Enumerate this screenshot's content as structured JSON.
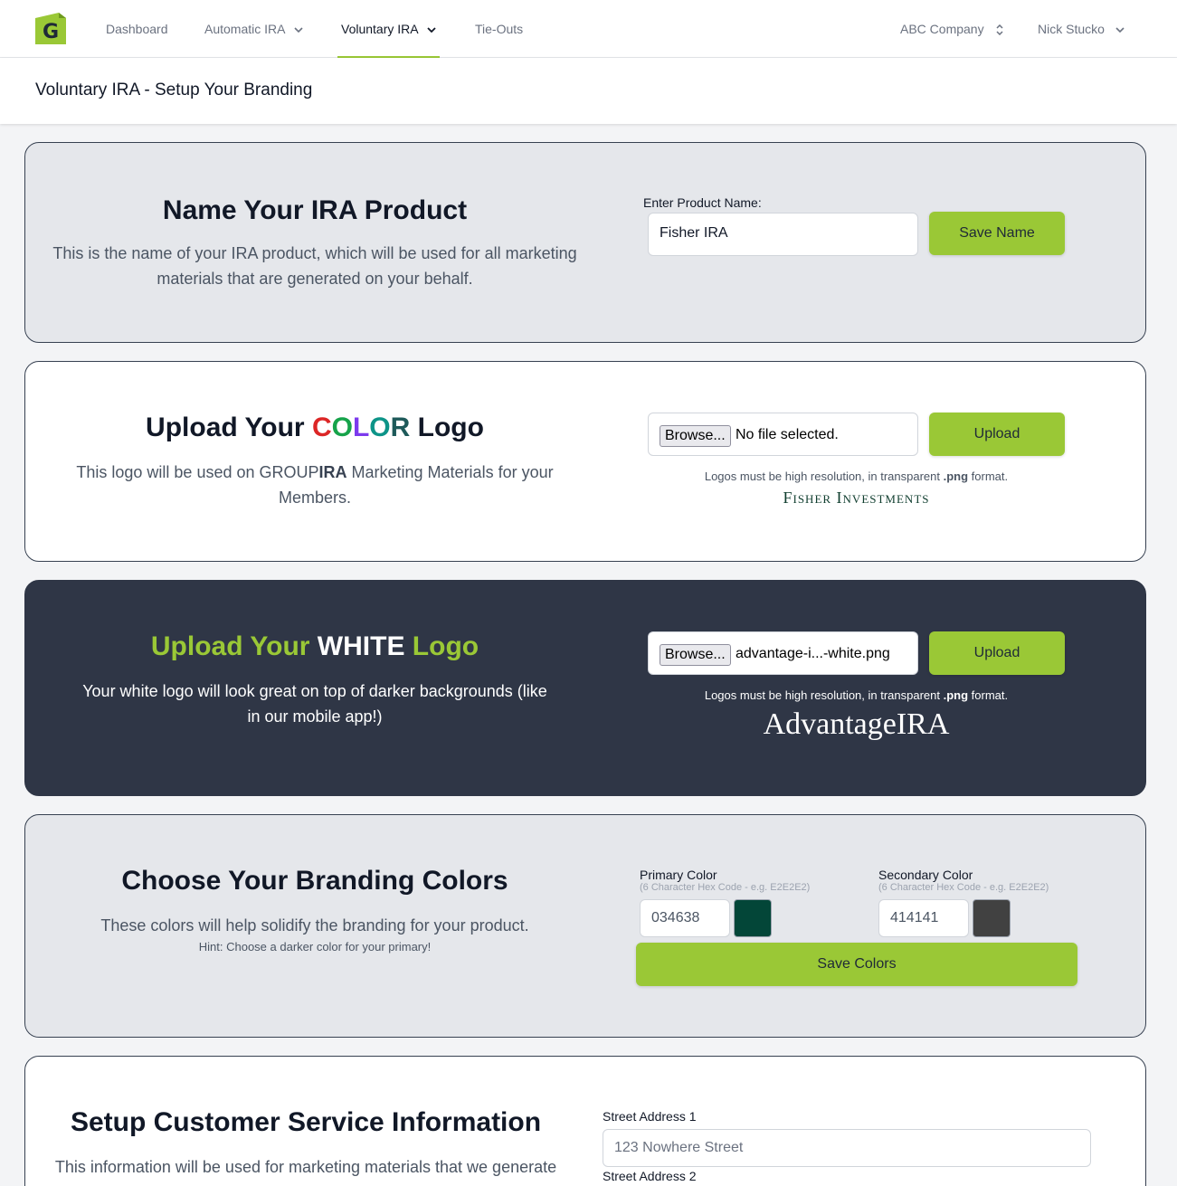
{
  "nav": {
    "items": [
      {
        "label": "Dashboard"
      },
      {
        "label": "Automatic IRA"
      },
      {
        "label": "Voluntary IRA"
      },
      {
        "label": "Tie-Outs"
      }
    ],
    "company": "ABC Company",
    "user": "Nick Stucko"
  },
  "page": {
    "title": "Voluntary IRA - Setup Your Branding"
  },
  "name_section": {
    "title": "Name Your IRA Product",
    "description": "This is the name of your IRA product, which will be used for all marketing materials that are generated on your behalf.",
    "field_label": "Enter Product Name:",
    "field_value": "Fisher IRA",
    "button": "Save Name"
  },
  "color_logo": {
    "title_prefix": "Upload Your ",
    "title_letters": [
      {
        "ch": "C",
        "color": "#dc2626"
      },
      {
        "ch": "O",
        "color": "#16a34a"
      },
      {
        "ch": "L",
        "color": "#7c3aed"
      },
      {
        "ch": "O",
        "color": "#0d9488"
      },
      {
        "ch": "R",
        "color": "#1e5a5a"
      }
    ],
    "title_suffix": " Logo",
    "description_prefix": "This logo will be used on GROUP",
    "description_bold": "IRA",
    "description_suffix": " Marketing Materials for your Members.",
    "browse": "Browse...",
    "file_name": "No file selected.",
    "button": "Upload",
    "note_prefix": "Logos must be high resolution, in transparent ",
    "note_bold": ".png",
    "note_suffix": " format.",
    "logo_text": "Fisher Investments",
    "logo_color": "#0f3d2e"
  },
  "white_logo": {
    "title_part1": "Upload Your ",
    "title_part2": "WHITE",
    "title_part3": " Logo",
    "description": "Your white logo will look great on top of darker backgrounds (like in our mobile app!)",
    "browse": "Browse...",
    "file_name": "advantage-i...-white.png",
    "button": "Upload",
    "note_prefix": "Logos must be high resolution, in transparent ",
    "note_bold": ".png",
    "note_suffix": " format.",
    "logo_text": "AdvantageIRA",
    "accent_color": "#9ac836"
  },
  "colors_section": {
    "title": "Choose Your Branding Colors",
    "description": "These colors will help solidify the branding for your product.",
    "hint": "Hint: Choose a darker color for your primary!",
    "primary_label": "Primary Color",
    "primary_sublabel": "(6 Character Hex Code - e.g. E2E2E2)",
    "primary_value": "034638",
    "primary_swatch": "#034638",
    "secondary_label": "Secondary Color",
    "secondary_sublabel": "(6 Character Hex Code - e.g. E2E2E2)",
    "secondary_value": "414141",
    "secondary_swatch": "#414141",
    "button": "Save Colors"
  },
  "customer_service": {
    "title": "Setup Customer Service Information",
    "description": "This information will be used for marketing materials that we generate",
    "street1_label": "Street Address 1",
    "street1_placeholder": "123 Nowhere Street",
    "street2_label": "Street Address 2"
  }
}
